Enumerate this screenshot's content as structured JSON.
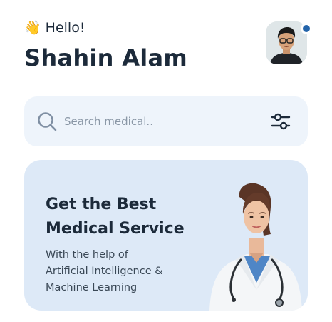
{
  "header": {
    "greeting_emoji": "👋",
    "greeting": "Hello!",
    "user_name": "Shahin Alam",
    "online_status_color": "#2364aa"
  },
  "search": {
    "placeholder": "Search medical..",
    "value": "",
    "icon": "search-icon",
    "filter_icon": "sliders-filter-icon"
  },
  "promo": {
    "title_line1": "Get the Best",
    "title_line2": "Medical Service",
    "subtitle_line1": "With the help of",
    "subtitle_line2": "Artificial Intelligence &",
    "subtitle_line3": "Machine Learning",
    "image": "female-doctor-illustration"
  },
  "colors": {
    "text_dark": "#1c2a3a",
    "search_bg": "#eef4fb",
    "card_bg": "#dde9f7",
    "accent": "#2364aa"
  }
}
